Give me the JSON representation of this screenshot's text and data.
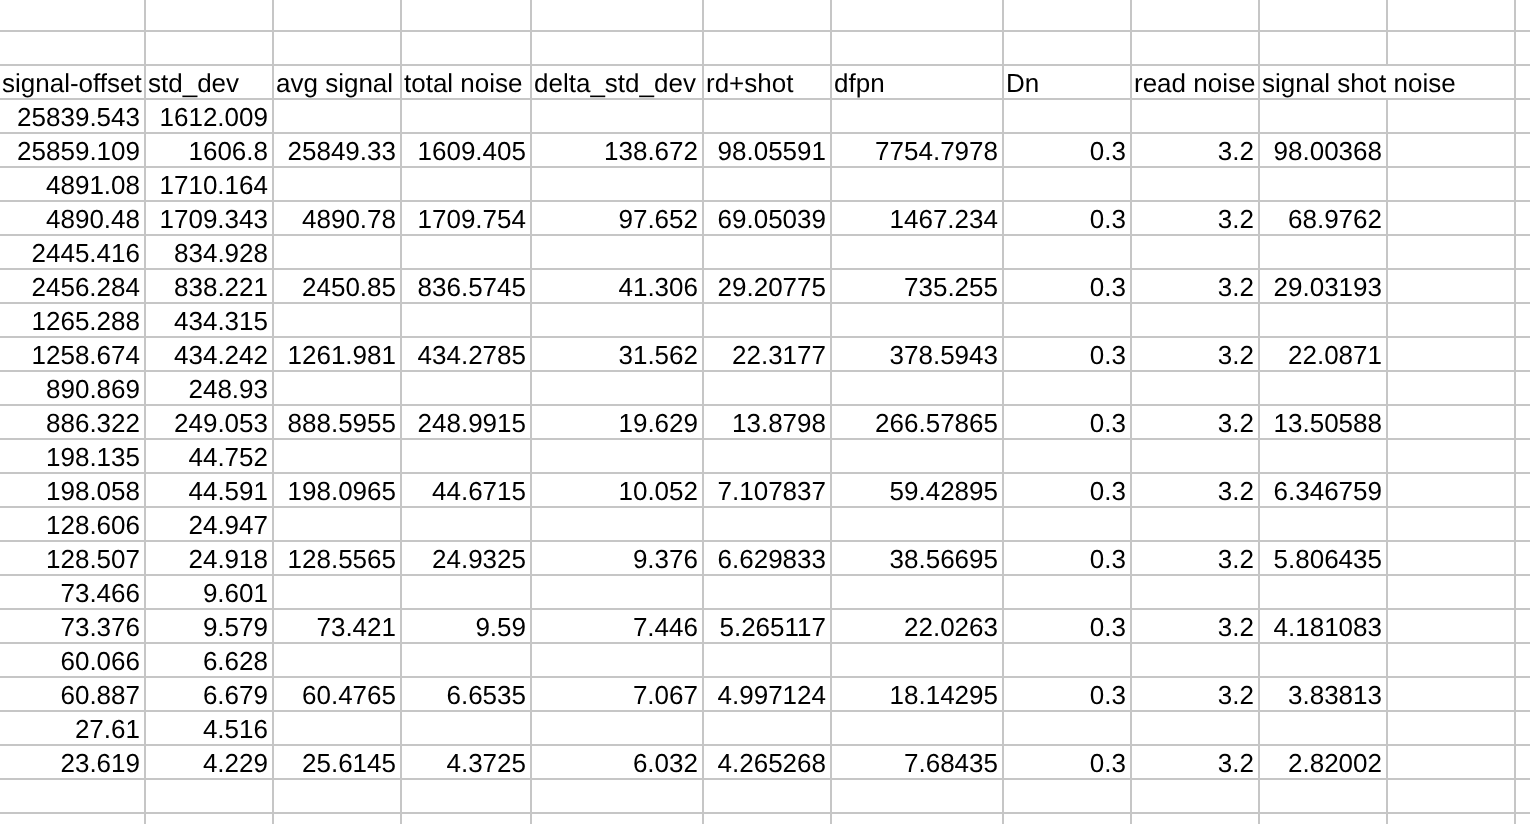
{
  "columns": [
    "signal-offset",
    "std_dev",
    "avg signal",
    "total noise",
    "delta_std_dev",
    "rd+shot",
    "dfpn",
    "Dn",
    "read noise",
    "signal shot noise"
  ],
  "rows": [
    [
      "25839.543",
      "1612.009",
      null,
      null,
      null,
      null,
      null,
      null,
      null,
      null
    ],
    [
      "25859.109",
      "1606.8",
      "25849.33",
      "1609.405",
      "138.672",
      "98.05591",
      "7754.7978",
      "0.3",
      "3.2",
      "98.00368"
    ],
    [
      "4891.08",
      "1710.164",
      null,
      null,
      null,
      null,
      null,
      null,
      null,
      null
    ],
    [
      "4890.48",
      "1709.343",
      "4890.78",
      "1709.754",
      "97.652",
      "69.05039",
      "1467.234",
      "0.3",
      "3.2",
      "68.9762"
    ],
    [
      "2445.416",
      "834.928",
      null,
      null,
      null,
      null,
      null,
      null,
      null,
      null
    ],
    [
      "2456.284",
      "838.221",
      "2450.85",
      "836.5745",
      "41.306",
      "29.20775",
      "735.255",
      "0.3",
      "3.2",
      "29.03193"
    ],
    [
      "1265.288",
      "434.315",
      null,
      null,
      null,
      null,
      null,
      null,
      null,
      null
    ],
    [
      "1258.674",
      "434.242",
      "1261.981",
      "434.2785",
      "31.562",
      "22.3177",
      "378.5943",
      "0.3",
      "3.2",
      "22.0871"
    ],
    [
      "890.869",
      "248.93",
      null,
      null,
      null,
      null,
      null,
      null,
      null,
      null
    ],
    [
      "886.322",
      "249.053",
      "888.5955",
      "248.9915",
      "19.629",
      "13.8798",
      "266.57865",
      "0.3",
      "3.2",
      "13.50588"
    ],
    [
      "198.135",
      "44.752",
      null,
      null,
      null,
      null,
      null,
      null,
      null,
      null
    ],
    [
      "198.058",
      "44.591",
      "198.0965",
      "44.6715",
      "10.052",
      "7.107837",
      "59.42895",
      "0.3",
      "3.2",
      "6.346759"
    ],
    [
      "128.606",
      "24.947",
      null,
      null,
      null,
      null,
      null,
      null,
      null,
      null
    ],
    [
      "128.507",
      "24.918",
      "128.5565",
      "24.9325",
      "9.376",
      "6.629833",
      "38.56695",
      "0.3",
      "3.2",
      "5.806435"
    ],
    [
      "73.466",
      "9.601",
      null,
      null,
      null,
      null,
      null,
      null,
      null,
      null
    ],
    [
      "73.376",
      "9.579",
      "73.421",
      "9.59",
      "7.446",
      "5.265117",
      "22.0263",
      "0.3",
      "3.2",
      "4.181083"
    ],
    [
      "60.066",
      "6.628",
      null,
      null,
      null,
      null,
      null,
      null,
      null,
      null
    ],
    [
      "60.887",
      "6.679",
      "60.4765",
      "6.6535",
      "7.067",
      "4.997124",
      "18.14295",
      "0.3",
      "3.2",
      "3.83813"
    ],
    [
      "27.61",
      "4.516",
      null,
      null,
      null,
      null,
      null,
      null,
      null,
      null
    ],
    [
      "23.619",
      "4.229",
      "25.6145",
      "4.3725",
      "6.032",
      "4.265268",
      "7.68435",
      "0.3",
      "3.2",
      "2.82002"
    ]
  ]
}
